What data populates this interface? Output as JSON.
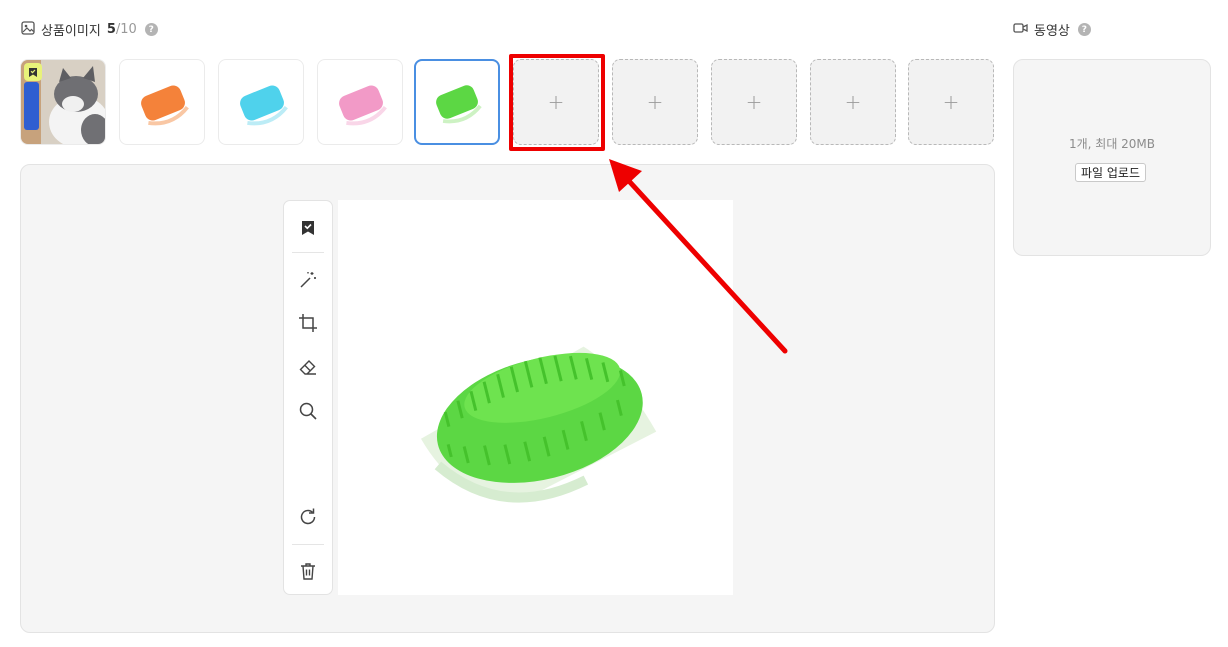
{
  "images": {
    "title": "상품이미지",
    "count_current": "5",
    "count_max": "/10",
    "help": "?",
    "thumbnails": [
      {
        "color": "cat photo with blue brush",
        "rep": true
      },
      {
        "color": "#f4823a"
      },
      {
        "color": "#4fd2ec"
      },
      {
        "color": "#f29ac7"
      },
      {
        "color": "#5cd744",
        "selected": true
      }
    ],
    "empty_slots": [
      "+",
      "+",
      "+",
      "+",
      "+"
    ]
  },
  "video": {
    "title": "동영상",
    "help": "?",
    "info": "1개, 최대 20MB",
    "upload_label": "파일 업로드"
  },
  "editor": {
    "tools": [
      "bookmark-icon",
      "magic-wand-icon",
      "crop-icon",
      "eraser-icon",
      "zoom-icon",
      "rotate-icon",
      "trash-icon"
    ],
    "preview_color": "#5cd744"
  },
  "annotation": {
    "color": "#ee0000"
  }
}
